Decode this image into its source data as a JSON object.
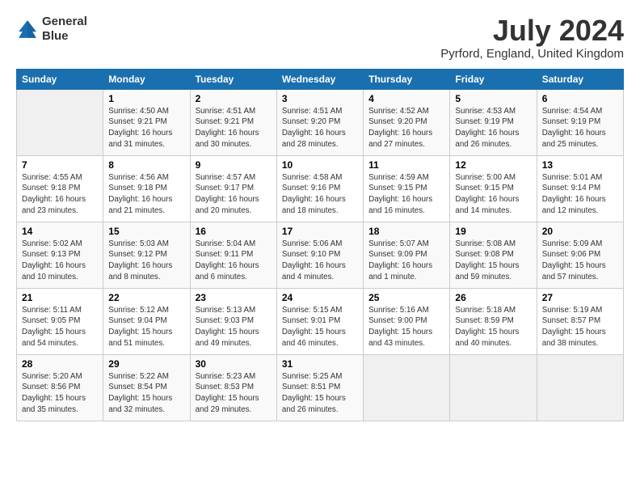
{
  "header": {
    "logo_line1": "General",
    "logo_line2": "Blue",
    "month_year": "July 2024",
    "location": "Pyrford, England, United Kingdom"
  },
  "days_of_week": [
    "Sunday",
    "Monday",
    "Tuesday",
    "Wednesday",
    "Thursday",
    "Friday",
    "Saturday"
  ],
  "weeks": [
    [
      {
        "day": "",
        "info": ""
      },
      {
        "day": "1",
        "info": "Sunrise: 4:50 AM\nSunset: 9:21 PM\nDaylight: 16 hours\nand 31 minutes."
      },
      {
        "day": "2",
        "info": "Sunrise: 4:51 AM\nSunset: 9:21 PM\nDaylight: 16 hours\nand 30 minutes."
      },
      {
        "day": "3",
        "info": "Sunrise: 4:51 AM\nSunset: 9:20 PM\nDaylight: 16 hours\nand 28 minutes."
      },
      {
        "day": "4",
        "info": "Sunrise: 4:52 AM\nSunset: 9:20 PM\nDaylight: 16 hours\nand 27 minutes."
      },
      {
        "day": "5",
        "info": "Sunrise: 4:53 AM\nSunset: 9:19 PM\nDaylight: 16 hours\nand 26 minutes."
      },
      {
        "day": "6",
        "info": "Sunrise: 4:54 AM\nSunset: 9:19 PM\nDaylight: 16 hours\nand 25 minutes."
      }
    ],
    [
      {
        "day": "7",
        "info": "Sunrise: 4:55 AM\nSunset: 9:18 PM\nDaylight: 16 hours\nand 23 minutes."
      },
      {
        "day": "8",
        "info": "Sunrise: 4:56 AM\nSunset: 9:18 PM\nDaylight: 16 hours\nand 21 minutes."
      },
      {
        "day": "9",
        "info": "Sunrise: 4:57 AM\nSunset: 9:17 PM\nDaylight: 16 hours\nand 20 minutes."
      },
      {
        "day": "10",
        "info": "Sunrise: 4:58 AM\nSunset: 9:16 PM\nDaylight: 16 hours\nand 18 minutes."
      },
      {
        "day": "11",
        "info": "Sunrise: 4:59 AM\nSunset: 9:15 PM\nDaylight: 16 hours\nand 16 minutes."
      },
      {
        "day": "12",
        "info": "Sunrise: 5:00 AM\nSunset: 9:15 PM\nDaylight: 16 hours\nand 14 minutes."
      },
      {
        "day": "13",
        "info": "Sunrise: 5:01 AM\nSunset: 9:14 PM\nDaylight: 16 hours\nand 12 minutes."
      }
    ],
    [
      {
        "day": "14",
        "info": "Sunrise: 5:02 AM\nSunset: 9:13 PM\nDaylight: 16 hours\nand 10 minutes."
      },
      {
        "day": "15",
        "info": "Sunrise: 5:03 AM\nSunset: 9:12 PM\nDaylight: 16 hours\nand 8 minutes."
      },
      {
        "day": "16",
        "info": "Sunrise: 5:04 AM\nSunset: 9:11 PM\nDaylight: 16 hours\nand 6 minutes."
      },
      {
        "day": "17",
        "info": "Sunrise: 5:06 AM\nSunset: 9:10 PM\nDaylight: 16 hours\nand 4 minutes."
      },
      {
        "day": "18",
        "info": "Sunrise: 5:07 AM\nSunset: 9:09 PM\nDaylight: 16 hours\nand 1 minute."
      },
      {
        "day": "19",
        "info": "Sunrise: 5:08 AM\nSunset: 9:08 PM\nDaylight: 15 hours\nand 59 minutes."
      },
      {
        "day": "20",
        "info": "Sunrise: 5:09 AM\nSunset: 9:06 PM\nDaylight: 15 hours\nand 57 minutes."
      }
    ],
    [
      {
        "day": "21",
        "info": "Sunrise: 5:11 AM\nSunset: 9:05 PM\nDaylight: 15 hours\nand 54 minutes."
      },
      {
        "day": "22",
        "info": "Sunrise: 5:12 AM\nSunset: 9:04 PM\nDaylight: 15 hours\nand 51 minutes."
      },
      {
        "day": "23",
        "info": "Sunrise: 5:13 AM\nSunset: 9:03 PM\nDaylight: 15 hours\nand 49 minutes."
      },
      {
        "day": "24",
        "info": "Sunrise: 5:15 AM\nSunset: 9:01 PM\nDaylight: 15 hours\nand 46 minutes."
      },
      {
        "day": "25",
        "info": "Sunrise: 5:16 AM\nSunset: 9:00 PM\nDaylight: 15 hours\nand 43 minutes."
      },
      {
        "day": "26",
        "info": "Sunrise: 5:18 AM\nSunset: 8:59 PM\nDaylight: 15 hours\nand 40 minutes."
      },
      {
        "day": "27",
        "info": "Sunrise: 5:19 AM\nSunset: 8:57 PM\nDaylight: 15 hours\nand 38 minutes."
      }
    ],
    [
      {
        "day": "28",
        "info": "Sunrise: 5:20 AM\nSunset: 8:56 PM\nDaylight: 15 hours\nand 35 minutes."
      },
      {
        "day": "29",
        "info": "Sunrise: 5:22 AM\nSunset: 8:54 PM\nDaylight: 15 hours\nand 32 minutes."
      },
      {
        "day": "30",
        "info": "Sunrise: 5:23 AM\nSunset: 8:53 PM\nDaylight: 15 hours\nand 29 minutes."
      },
      {
        "day": "31",
        "info": "Sunrise: 5:25 AM\nSunset: 8:51 PM\nDaylight: 15 hours\nand 26 minutes."
      },
      {
        "day": "",
        "info": ""
      },
      {
        "day": "",
        "info": ""
      },
      {
        "day": "",
        "info": ""
      }
    ]
  ]
}
